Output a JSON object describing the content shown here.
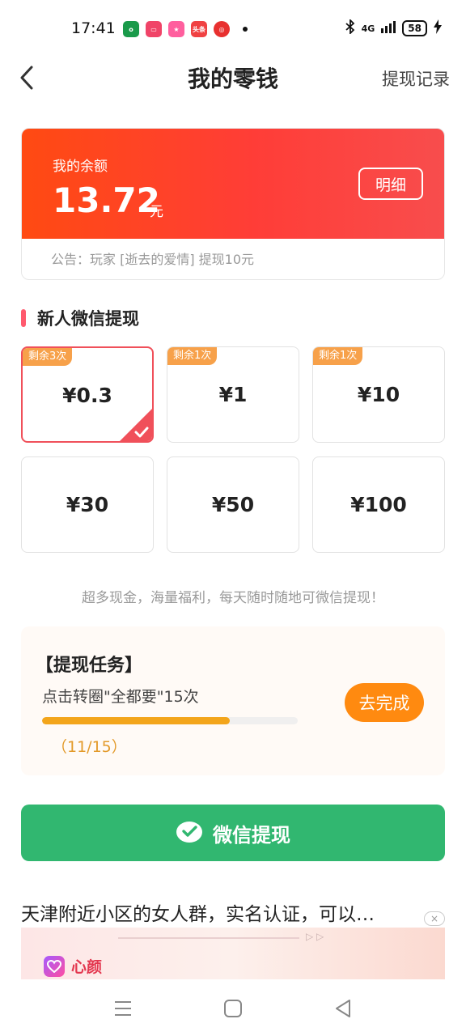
{
  "status_bar": {
    "time": "17:41",
    "apps": [
      "oppo-store",
      "video",
      "mall",
      "toutiao",
      "netease-music"
    ],
    "app_labels": {
      "toutiao": "头条"
    },
    "network": "4G",
    "battery": "58"
  },
  "header": {
    "title": "我的零钱",
    "history_link": "提现记录"
  },
  "balance": {
    "label": "我的余额",
    "amount": "13.72",
    "unit": "元",
    "detail_button": "明细",
    "notice": "公告：玩家 [逝去的爱情] 提现10元",
    "gradient_colors": [
      "#ff4a12",
      "#f84d4d"
    ]
  },
  "section": {
    "title": "新人微信提现",
    "accent_color": "#ff5a6e"
  },
  "options": [
    {
      "value": "¥0.3",
      "badge": "剩余3次",
      "selected": true
    },
    {
      "value": "¥1",
      "badge": "剩余1次",
      "selected": false
    },
    {
      "value": "¥10",
      "badge": "剩余1次",
      "selected": false
    },
    {
      "value": "¥30",
      "badge": "",
      "selected": false
    },
    {
      "value": "¥50",
      "badge": "",
      "selected": false
    },
    {
      "value": "¥100",
      "badge": "",
      "selected": false
    }
  ],
  "promo_text": "超多现金，海量福利，每天随时随地可微信提现！",
  "task": {
    "title": "【提现任务】",
    "description": "点击转圈\"全都要\"15次",
    "progress_text": "（11/15）",
    "progress_fraction": 0.733,
    "button": "去完成",
    "button_color": "#ff8a10"
  },
  "withdraw_button": {
    "label": "微信提现",
    "color": "#31b770"
  },
  "ad": {
    "title": "天津附近小区的女人群，实名认证，可以…",
    "brand": "心颜",
    "close": "×"
  }
}
